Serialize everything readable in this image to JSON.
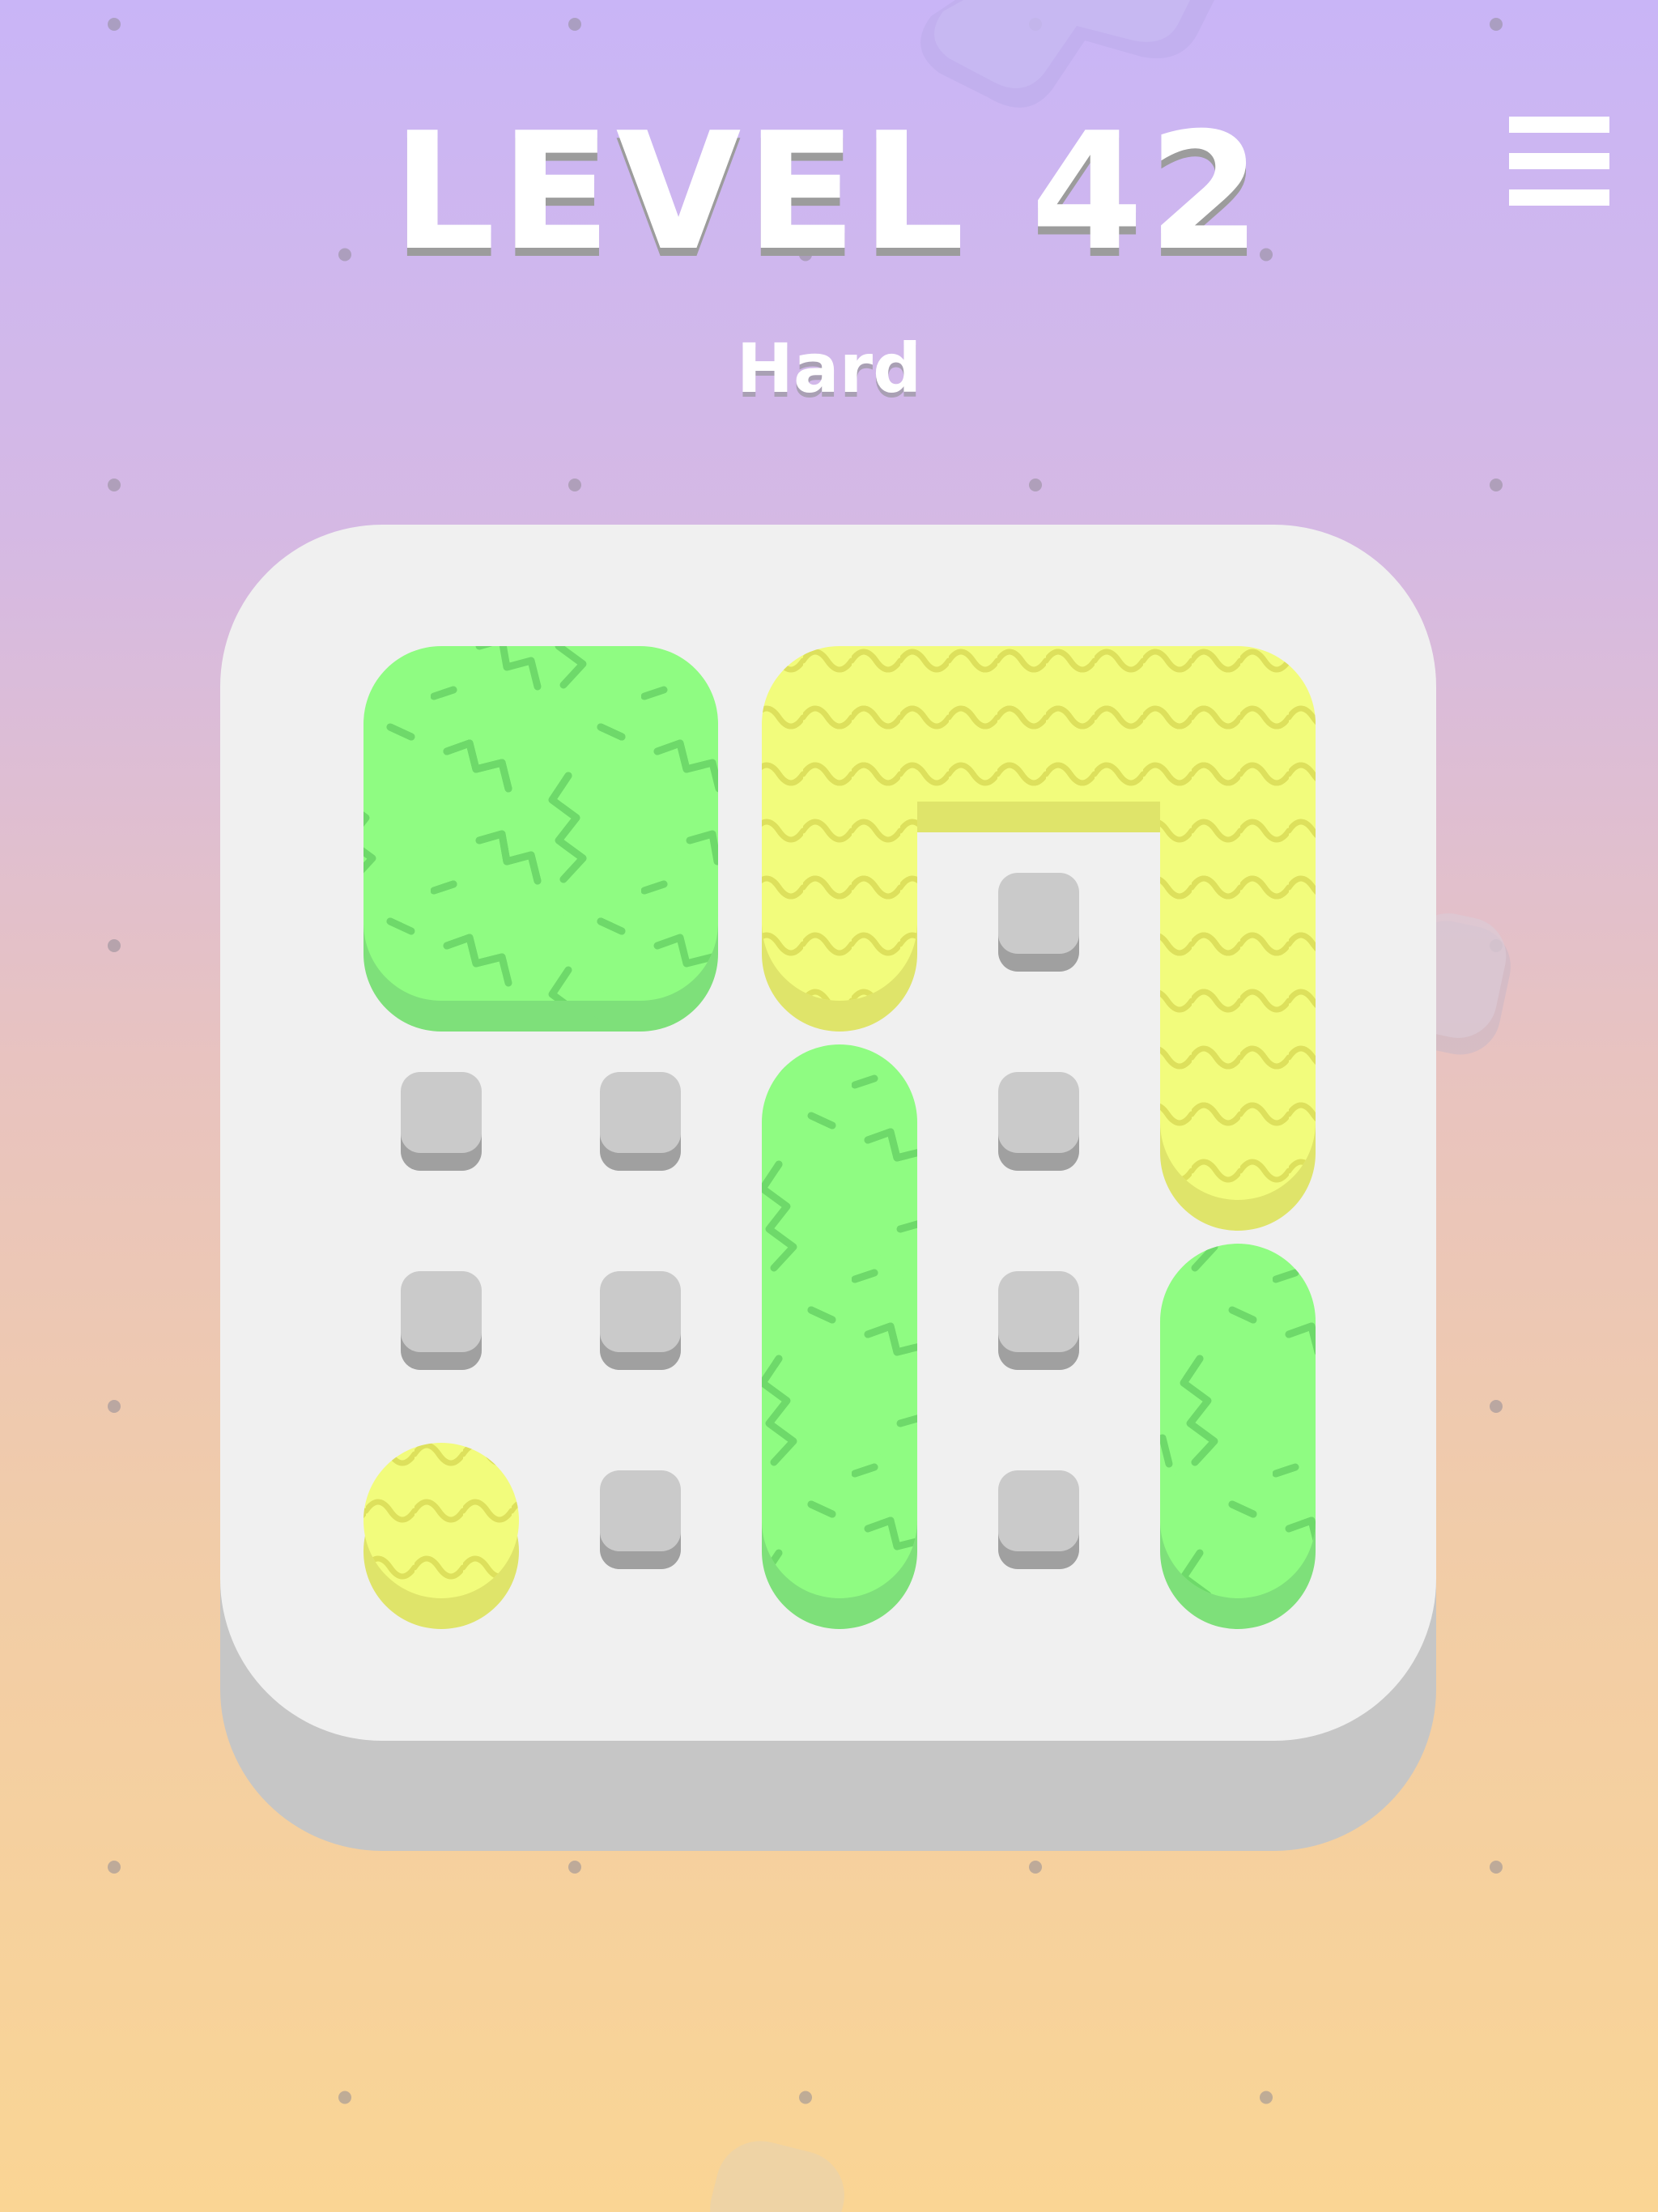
{
  "header": {
    "level_title": "LEVEL 42",
    "difficulty": "Hard"
  },
  "menu": {
    "icon": "hamburger-menu-icon"
  },
  "colors": {
    "background_top": "#c9b5f7",
    "background_bottom": "#fad594",
    "board_face": "#f0f0f0",
    "board_edge": "#c6c6c6",
    "peg_top": "#cacaca",
    "peg_side": "#a0a0a0",
    "green_fill": "#8ffc82",
    "green_pattern": "#6ed96a",
    "green_shadow": "#7ee07a",
    "yellow_fill": "#f2fc7c",
    "yellow_pattern": "#dde05c",
    "yellow_shadow": "#dfe46a"
  },
  "board": {
    "columns": 5,
    "rows": 5,
    "empty_pegs": [
      {
        "col": 3,
        "row": 1
      },
      {
        "col": 0,
        "row": 2
      },
      {
        "col": 1,
        "row": 2
      },
      {
        "col": 3,
        "row": 2
      },
      {
        "col": 0,
        "row": 3
      },
      {
        "col": 1,
        "row": 3
      },
      {
        "col": 3,
        "row": 3
      },
      {
        "col": 1,
        "row": 4
      },
      {
        "col": 3,
        "row": 4
      }
    ],
    "pieces": [
      {
        "id": "green-square",
        "color": "green",
        "pattern": "zigzag",
        "cells": [
          [
            0,
            0
          ],
          [
            1,
            0
          ],
          [
            0,
            1
          ],
          [
            1,
            1
          ]
        ]
      },
      {
        "id": "yellow-arch",
        "color": "yellow",
        "pattern": "wave",
        "cells": [
          [
            2,
            0
          ],
          [
            3,
            0
          ],
          [
            4,
            0
          ],
          [
            2,
            1
          ],
          [
            4,
            1
          ],
          [
            4,
            2
          ]
        ]
      },
      {
        "id": "green-tall-center",
        "color": "green",
        "pattern": "zigzag",
        "cells": [
          [
            2,
            2
          ],
          [
            2,
            3
          ],
          [
            2,
            4
          ]
        ]
      },
      {
        "id": "green-tall-right",
        "color": "green",
        "pattern": "zigzag",
        "cells": [
          [
            4,
            3
          ],
          [
            4,
            4
          ]
        ]
      },
      {
        "id": "yellow-single",
        "color": "yellow",
        "pattern": "wave",
        "cells": [
          [
            0,
            4
          ]
        ]
      }
    ]
  }
}
